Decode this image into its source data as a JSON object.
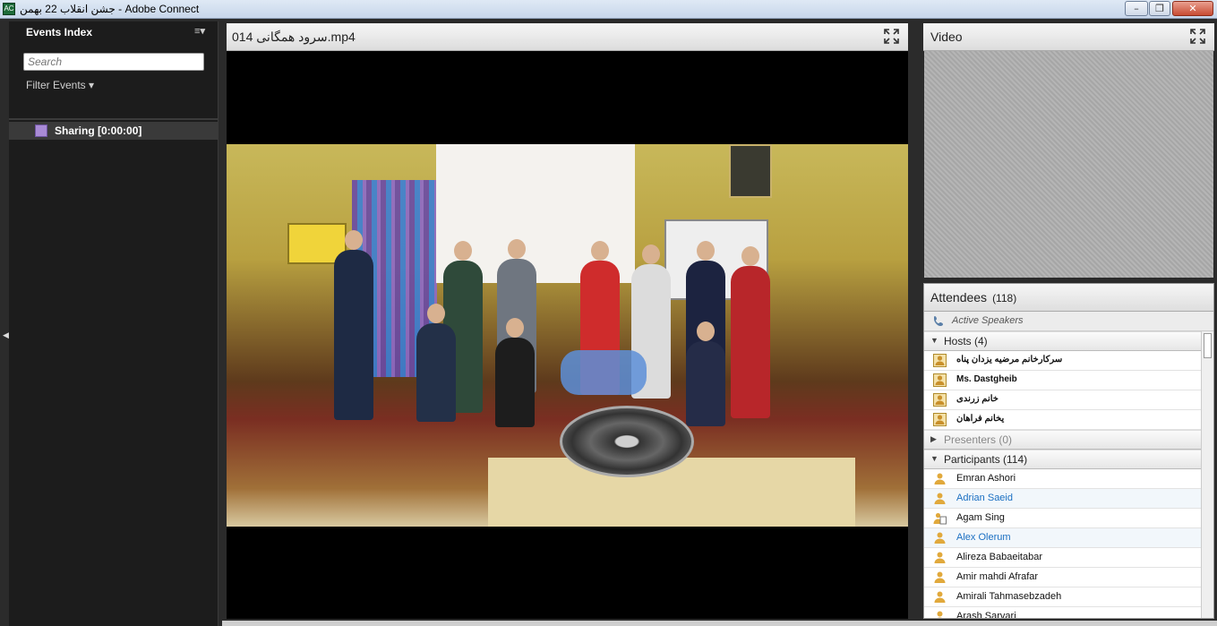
{
  "window": {
    "title": "جشن انقلاب 22 بهمن - Adobe Connect",
    "icon_text": "AC",
    "minimize": "–",
    "maximize": "❐",
    "close": "✕"
  },
  "events_index": {
    "title": "Events Index",
    "menu_glyph": "≡▾",
    "search_placeholder": "Search",
    "filter_label": "Filter Events ▾",
    "items": [
      {
        "label": "Sharing [0:00:00]"
      }
    ]
  },
  "share_pod": {
    "title": "014 سرود همگانی.mp4"
  },
  "video_pod": {
    "title": "Video"
  },
  "attendees": {
    "title": "Attendees",
    "count": "(118)",
    "active_speakers": "Active Speakers",
    "hosts_label": "Hosts (4)",
    "hosts": [
      {
        "name": "سرکارخانم مرضیه یزدان پناه"
      },
      {
        "name": "Ms. Dastgheib"
      },
      {
        "name": "خانم زرندی"
      },
      {
        "name": "یخانم فراهان"
      }
    ],
    "presenters_label": "Presenters (0)",
    "participants_label": "Participants (114)",
    "participants": [
      {
        "name": "Emran  Ashori",
        "style": "normal"
      },
      {
        "name": "Adrian Saeid",
        "style": "blue"
      },
      {
        "name": "Agam Sing",
        "style": "normal"
      },
      {
        "name": "Alex Olerum",
        "style": "blue"
      },
      {
        "name": "Alireza Babaeitabar",
        "style": "normal"
      },
      {
        "name": "Amir mahdi Afrafar",
        "style": "normal"
      },
      {
        "name": "Amirali Tahmasebzadeh",
        "style": "normal"
      },
      {
        "name": "Arash Sarvari",
        "style": "normal"
      }
    ]
  },
  "colors": {
    "accent_blue": "#1a6fc2",
    "panel_dark": "#1c1c1c",
    "sharing_icon": "#a98bd6"
  }
}
